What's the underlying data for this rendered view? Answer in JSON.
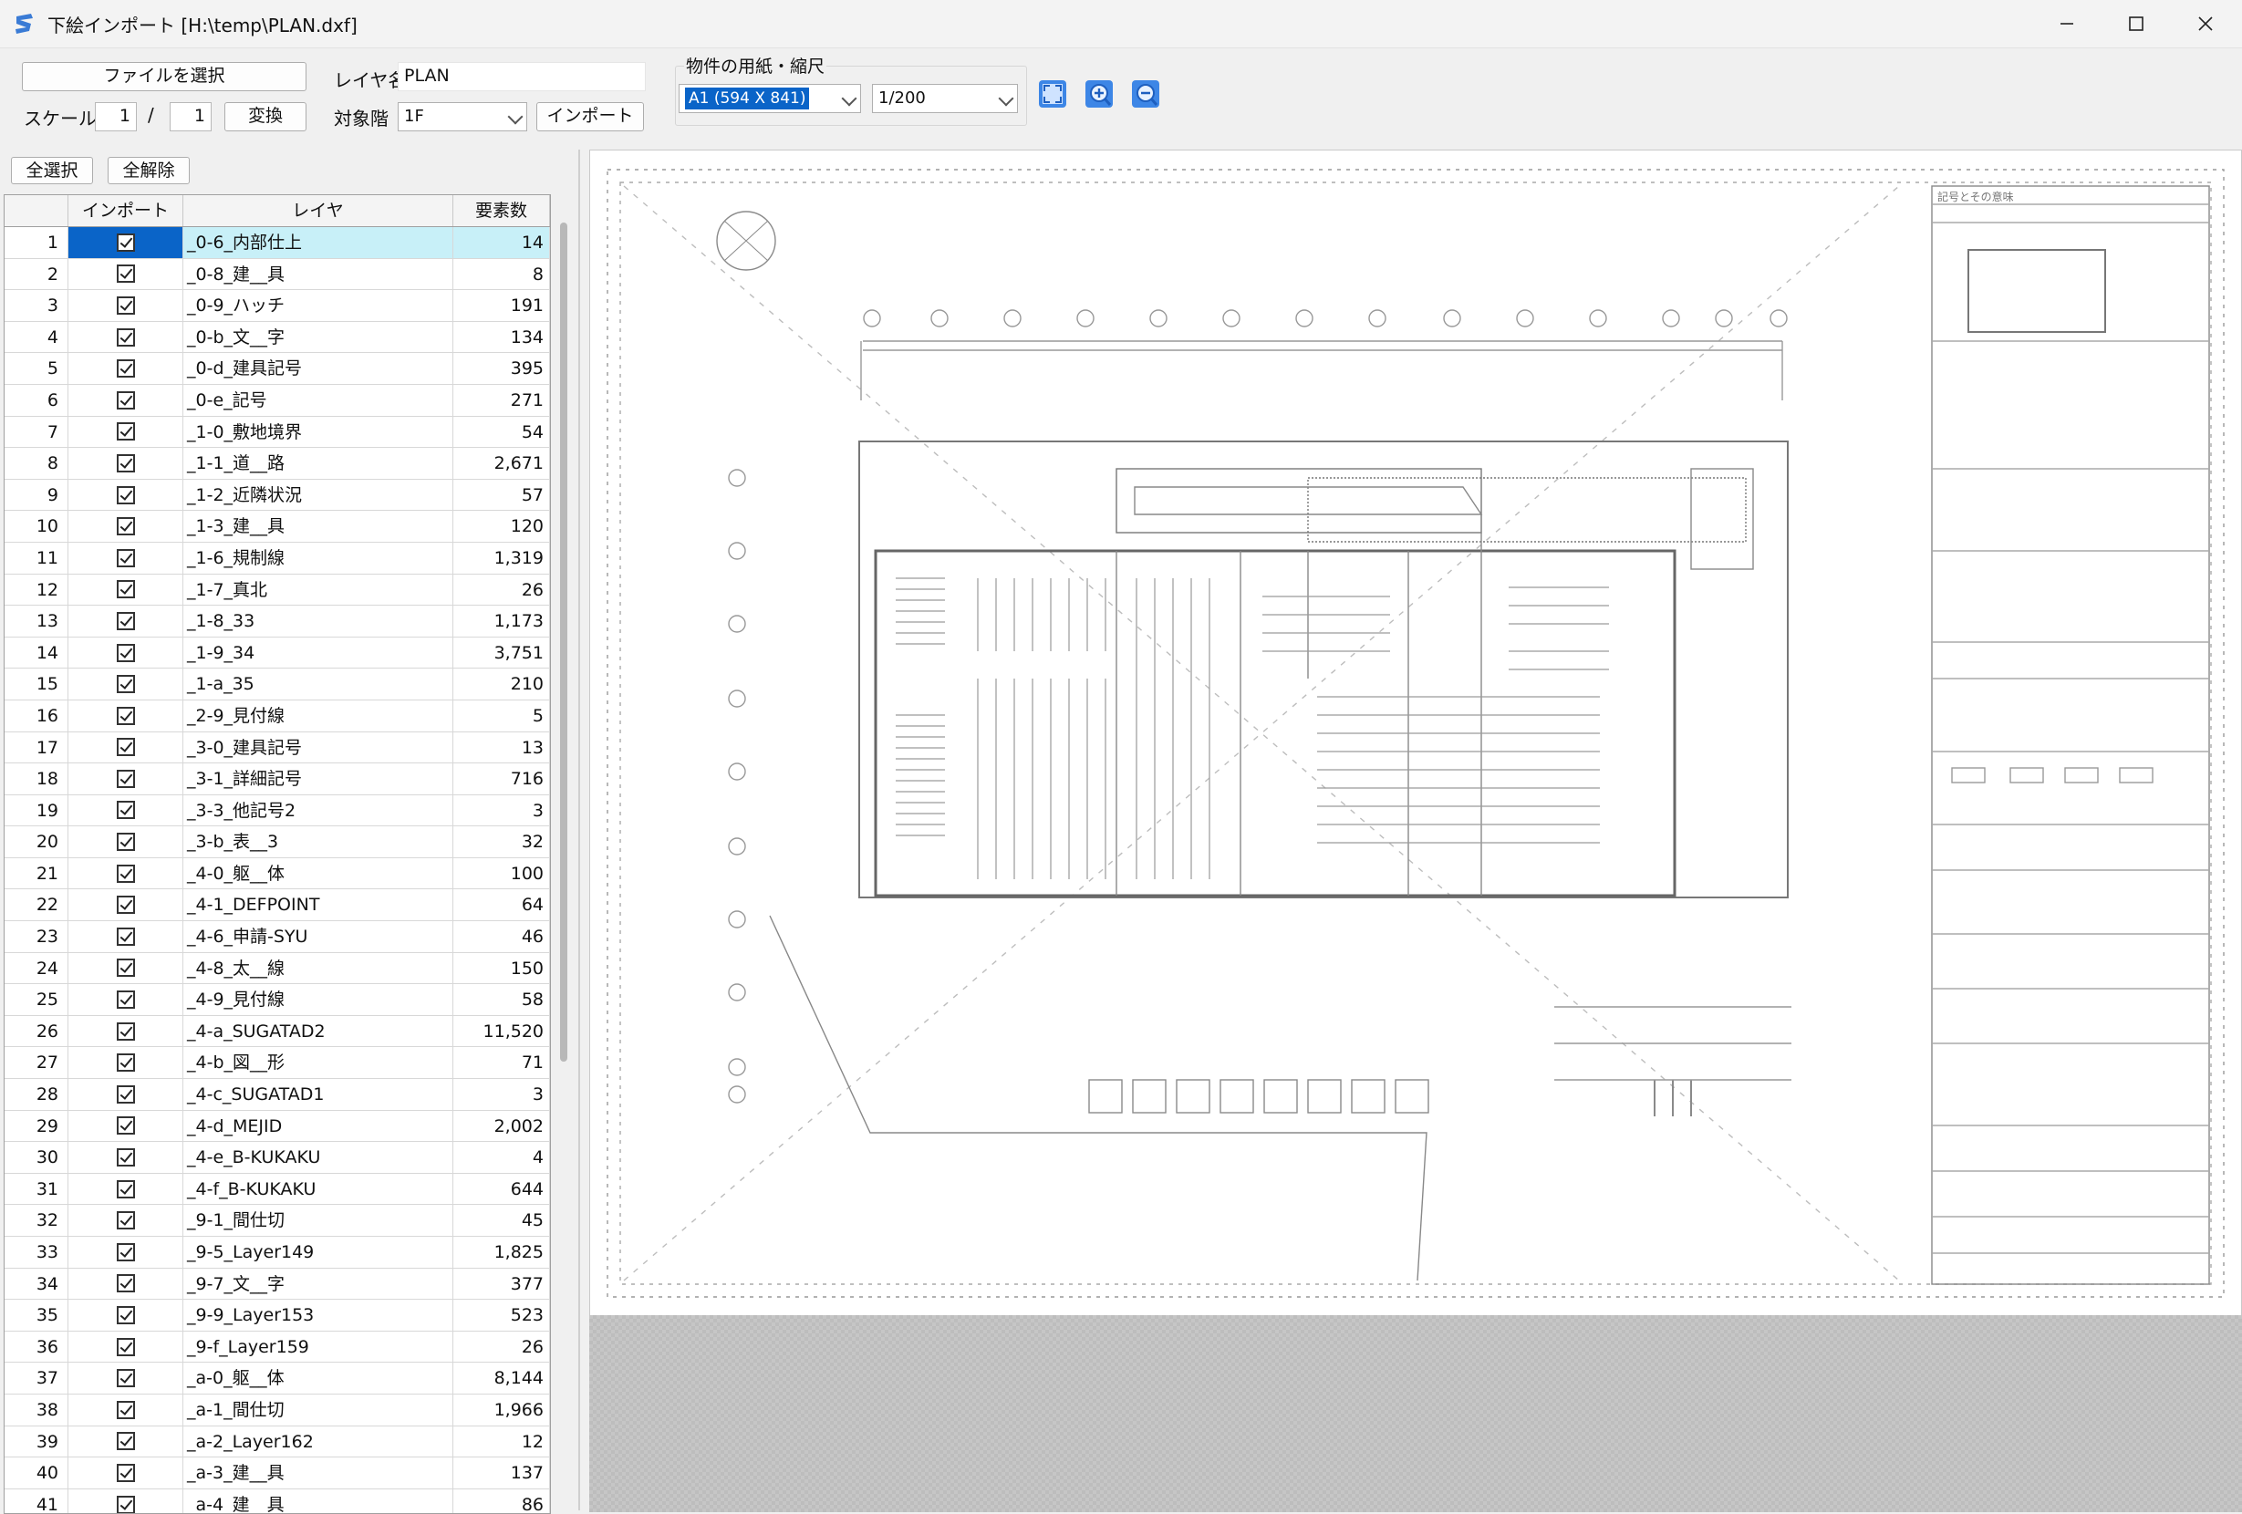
{
  "window": {
    "title": "下絵インポート [H:\\temp\\PLAN.dxf]",
    "minimize_icon": "minimize-icon",
    "maximize_icon": "maximize-icon",
    "close_icon": "close-icon"
  },
  "toolbar": {
    "select_file_label": "ファイルを選択",
    "layer_name_label": "レイヤ名",
    "layer_name_value": "PLAN",
    "scale_label": "スケール",
    "scale_num": "1",
    "scale_sep": "/",
    "scale_den": "1",
    "convert_label": "変換",
    "floor_label": "対象階",
    "floor_value": "1F",
    "import_label": "インポート",
    "paper_group_label": "物件の用紙・縮尺",
    "paper_value": "A1 (594 X 841)",
    "ratio_value": "1/200",
    "tools": [
      "fit-view-icon",
      "zoom-in-icon",
      "zoom-out-icon"
    ]
  },
  "list": {
    "select_all_label": "全選択",
    "deselect_all_label": "全解除",
    "columns": {
      "import": "インポート",
      "layer": "レイヤ",
      "count": "要素数"
    },
    "selected_row": 1,
    "rows": [
      {
        "n": "1",
        "name": "_0-6_内部仕上",
        "count": "14"
      },
      {
        "n": "2",
        "name": "_0-8_建__具",
        "count": "8"
      },
      {
        "n": "3",
        "name": "_0-9_ハッチ",
        "count": "191"
      },
      {
        "n": "4",
        "name": "_0-b_文__字",
        "count": "134"
      },
      {
        "n": "5",
        "name": "_0-d_建具記号",
        "count": "395"
      },
      {
        "n": "6",
        "name": "_0-e_記号",
        "count": "271"
      },
      {
        "n": "7",
        "name": "_1-0_敷地境界",
        "count": "54"
      },
      {
        "n": "8",
        "name": "_1-1_道__路",
        "count": "2,671"
      },
      {
        "n": "9",
        "name": "_1-2_近隣状況",
        "count": "57"
      },
      {
        "n": "10",
        "name": "_1-3_建__具",
        "count": "120"
      },
      {
        "n": "11",
        "name": "_1-6_規制線",
        "count": "1,319"
      },
      {
        "n": "12",
        "name": "_1-7_真北",
        "count": "26"
      },
      {
        "n": "13",
        "name": "_1-8_33",
        "count": "1,173"
      },
      {
        "n": "14",
        "name": "_1-9_34",
        "count": "3,751"
      },
      {
        "n": "15",
        "name": "_1-a_35",
        "count": "210"
      },
      {
        "n": "16",
        "name": "_2-9_見付線",
        "count": "5"
      },
      {
        "n": "17",
        "name": "_3-0_建具記号",
        "count": "13"
      },
      {
        "n": "18",
        "name": "_3-1_詳細記号",
        "count": "716"
      },
      {
        "n": "19",
        "name": "_3-3_他記号2",
        "count": "3"
      },
      {
        "n": "20",
        "name": "_3-b_表__3",
        "count": "32"
      },
      {
        "n": "21",
        "name": "_4-0_躯__体",
        "count": "100"
      },
      {
        "n": "22",
        "name": "_4-1_DEFPOINT",
        "count": "64"
      },
      {
        "n": "23",
        "name": "_4-6_申請-SYU",
        "count": "46"
      },
      {
        "n": "24",
        "name": "_4-8_太__線",
        "count": "150"
      },
      {
        "n": "25",
        "name": "_4-9_見付線",
        "count": "58"
      },
      {
        "n": "26",
        "name": "_4-a_SUGATAD2",
        "count": "11,520"
      },
      {
        "n": "27",
        "name": "_4-b_図__形",
        "count": "71"
      },
      {
        "n": "28",
        "name": "_4-c_SUGATAD1",
        "count": "3"
      },
      {
        "n": "29",
        "name": "_4-d_MEJID",
        "count": "2,002"
      },
      {
        "n": "30",
        "name": "_4-e_B-KUKAKU",
        "count": "4"
      },
      {
        "n": "31",
        "name": "_4-f_B-KUKAKU",
        "count": "644"
      },
      {
        "n": "32",
        "name": "_9-1_間仕切",
        "count": "45"
      },
      {
        "n": "33",
        "name": "_9-5_Layer149",
        "count": "1,825"
      },
      {
        "n": "34",
        "name": "_9-7_文__字",
        "count": "377"
      },
      {
        "n": "35",
        "name": "_9-9_Layer153",
        "count": "523"
      },
      {
        "n": "36",
        "name": "_9-f_Layer159",
        "count": "26"
      },
      {
        "n": "37",
        "name": "_a-0_躯__体",
        "count": "8,144"
      },
      {
        "n": "38",
        "name": "_a-1_間仕切",
        "count": "1,966"
      },
      {
        "n": "39",
        "name": "_a-2_Layer162",
        "count": "12"
      },
      {
        "n": "40",
        "name": "_a-3_建__具",
        "count": "137"
      },
      {
        "n": "41",
        "name": "_a-4_建__具",
        "count": "86"
      }
    ]
  },
  "preview": {
    "drawing_icon": "floor-plan-drawing",
    "legend_title": "記号とその意味"
  },
  "colors": {
    "selection": "#0a64c8",
    "row_highlight": "#c8f0f8",
    "tool_icon": "#1e6fd0"
  }
}
